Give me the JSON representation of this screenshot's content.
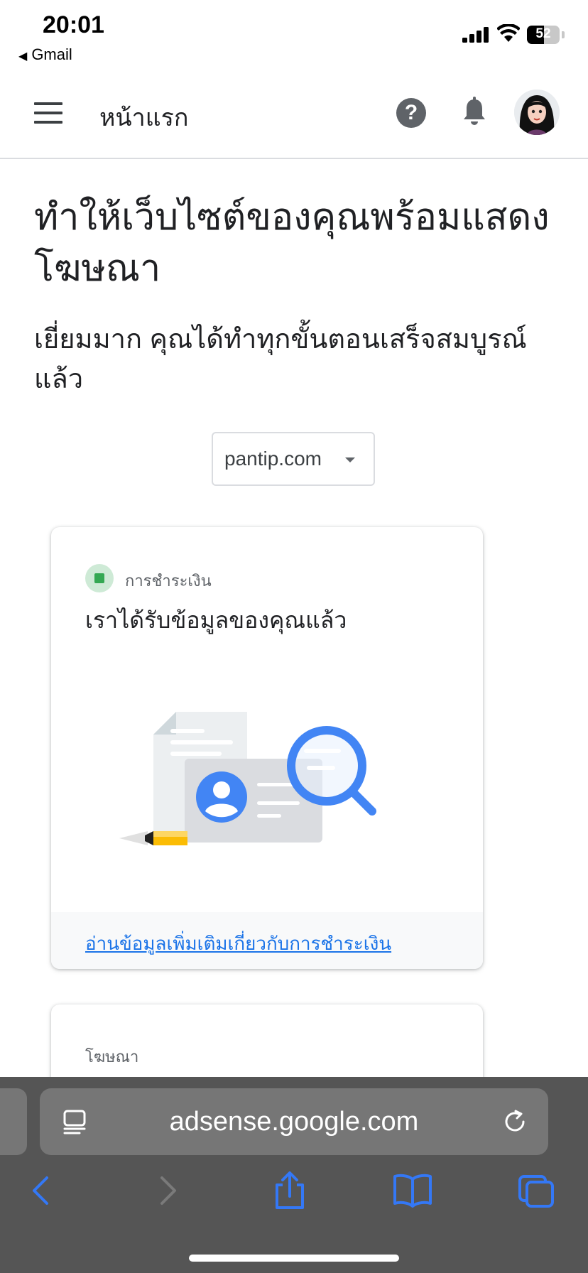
{
  "status_bar": {
    "time": "20:01",
    "back_app": "Gmail",
    "battery": "52",
    "battery_level": 0.52
  },
  "header": {
    "title": "หน้าแรก",
    "icons": [
      "menu-icon",
      "help-icon",
      "bell-icon",
      "avatar"
    ]
  },
  "main": {
    "title": "ทำให้เว็บไซต์ของคุณพร้อมแสดงโฆษณา",
    "subtitle": "เยี่ยมมาก คุณได้ทำทุกขั้นตอนเสร็จสมบูรณ์แล้ว",
    "site_selector": "pantip.com"
  },
  "cards": [
    {
      "label": "การชำระเงิน",
      "heading": "เราได้รับข้อมูลของคุณแล้ว",
      "link": "อ่านข้อมูลเพิ่มเติมเกี่ยวกับการชำระเงิน",
      "status_color": "#34a853"
    },
    {
      "label": "โฆษณา"
    }
  ],
  "browser": {
    "url": "adsense.google.com",
    "accent": "#3478f6"
  }
}
